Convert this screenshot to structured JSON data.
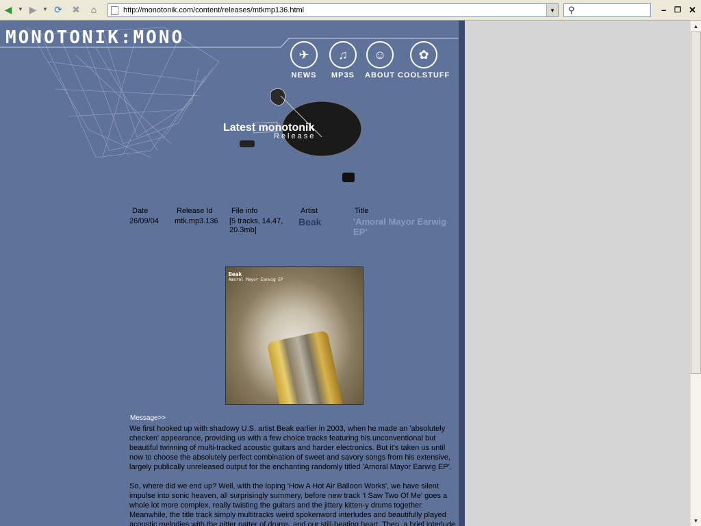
{
  "browser": {
    "url": "http://monotonik.com/content/releases/mtkmp136.html",
    "search_placeholder": ""
  },
  "site": {
    "logo": "MONOTONIK:MONO",
    "nav": [
      {
        "label": "NEWS",
        "icon": "news-icon"
      },
      {
        "label": "MP3S",
        "icon": "mp3s-icon"
      },
      {
        "label": "ABOUT",
        "icon": "about-icon"
      },
      {
        "label": "COOLSTUFF",
        "icon": "coolstuff-icon"
      }
    ],
    "banner_title": "Latest monotonik",
    "banner_sub": "Release"
  },
  "release": {
    "headers": {
      "date": "Date",
      "id": "Release Id",
      "info": "File info",
      "artist": "Artist",
      "title": "Title"
    },
    "date": "26/09/04",
    "id": "mtk.mp3.136",
    "info_line1": "[5 tracks, 14.47,",
    "info_line2": "20.3mb]",
    "artist": "Beak",
    "title": "'Amoral Mayor Earwig EP'"
  },
  "cover": {
    "artist": "Beak",
    "title": "Amoral Mayor Earwig EP"
  },
  "message": {
    "label": "Message>>",
    "p1": [
      "We first hooked up with shadowy U.S. artist Beak earlier in 2003, when he made an 'absolutely",
      "checken' appearance, providing us with a few choice tracks featuring his unconventional but",
      "beautiful twinning of multi-tracked acoustic guitars and harder electronics. But it's taken us until",
      "now to choose the absolutely perfect combination of sweet and savory songs from his extensive,",
      "largely publically unreleased output for the enchanting randomly titled 'Amoral Mayor Earwig EP'."
    ],
    "p2": [
      "So, where did we end up? Well, with the loping 'How A Hot Air Balloon Works', we have silent",
      "impulse into sonic heaven, all surprisingly summery, before new track 'I Saw Two Of Me' goes a",
      "whole lot more complex, really twisting the guitars and the jittery kitten-y drums together.",
      "Meanwhile, the title track simply multitracks weird spokenword interludes and beautifully played",
      "acoustic melodies with the pitter patter of drums, and our still-beating heart. Then, a brief interlude"
    ]
  },
  "colors": {
    "page_bg": "#5f7299",
    "artist": "#2c3a66",
    "title": "#8a9bbf"
  }
}
